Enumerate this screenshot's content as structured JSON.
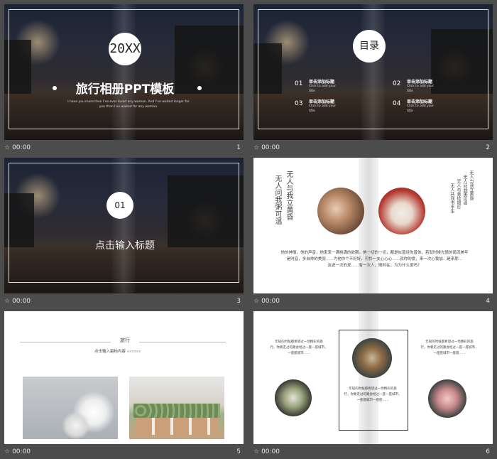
{
  "slides": [
    {
      "number": "1",
      "time": "00:00",
      "title": "旅行相册PPT模板",
      "circle": "20XX",
      "subtitle_1": "I have you more than I've ever loved any woman. And I've waited longer for",
      "subtitle_2": "you than I've waited for any woman."
    },
    {
      "number": "2",
      "time": "00:00",
      "circle": "目录",
      "items": [
        {
          "num": "01",
          "title": "单击添加标题",
          "en_1": "Click to add your",
          "en_2": "title"
        },
        {
          "num": "02",
          "title": "单击添加标题",
          "en_1": "Click to add your",
          "en_2": "title"
        },
        {
          "num": "03",
          "title": "单击添加标题",
          "en_1": "Click to add your",
          "en_2": "title"
        },
        {
          "num": "04",
          "title": "单击添加标题",
          "en_1": "Click to add your",
          "en_2": "title"
        }
      ]
    },
    {
      "number": "3",
      "time": "00:00",
      "circle": "01",
      "title": "点击输入标题"
    },
    {
      "number": "4",
      "time": "00:00",
      "vert_left_1": "无人与我立黄昏",
      "vert_left_2": "无人问我粥可温",
      "vert_right": [
        "无人与我立黄昏",
        "无人问我粥可温",
        "无人与我捻熄灯",
        "无人共我书半生"
      ],
      "paragraph_1": "他的神情，他的声音，他来来一满桃满的欲期。他一切的一切，都是似曾经你曾体，若就时候光情的简流美年",
      "paragraph_2": "是时音，多自帅的美丽……为他你个不好好，可怜一支心心心……就你的爱，来一次心我加…是来那…",
      "paragraph_3": "这说一次的爱……有一次人，随时在，为为什么爱吗？"
    },
    {
      "number": "5",
      "time": "00:00",
      "heading": "旅行",
      "subheading": "点击输入副标内容",
      "subheading_mark": "xxxxxx"
    },
    {
      "number": "6",
      "time": "00:00",
      "text_a": [
        "年轻的时候都希望过一场精彩的旅",
        "行，你要走过的路会经过一座一座城市，",
        "一座座城市……"
      ],
      "text_b": [
        "年轻的时候都希望过一场精彩的旅",
        "行，你要走过的路会经过一座一座城市，",
        "一座座城市一座座……"
      ],
      "text_c": [
        "年轻的时候都希望过一场精彩的旅",
        "行，你要走过的路会经过一座一座城市，",
        "一座座城市一座座……"
      ]
    }
  ],
  "icons": {
    "slide_meta": "star-icon",
    "star_glyph": "☆"
  }
}
